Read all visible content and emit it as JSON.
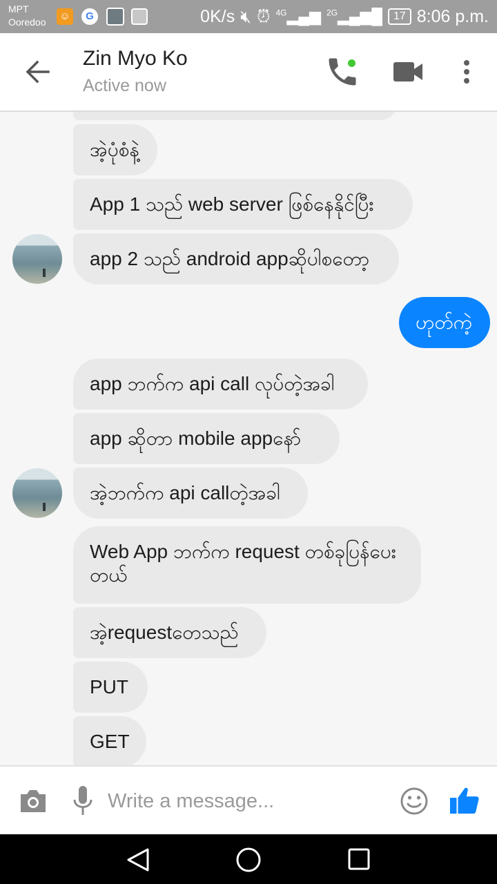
{
  "status_bar": {
    "carrier_1": "MPT",
    "carrier_2": "Ooredoo",
    "speed": "0K/s",
    "net_1": "4G",
    "net_2": "2G",
    "battery": "17",
    "time": "8:06 p.m."
  },
  "header": {
    "contact_name": "Zin Myo Ko",
    "status": "Active now"
  },
  "messages": [
    {
      "text": "အဲ့ပုံစံနဲ့",
      "from": "them"
    },
    {
      "text": "App 1 သည် web server ဖြစ်နေနိုင်ပြီး",
      "from": "them"
    },
    {
      "text": "app 2 သည် android appဆိုပါစတော့",
      "from": "them"
    },
    {
      "text": "ဟုတ်ကဲ့",
      "from": "me"
    },
    {
      "text": "app ဘက်က api call လုပ်တဲ့အခါ",
      "from": "them"
    },
    {
      "text": "app ဆိုတာ mobile appနော်",
      "from": "them"
    },
    {
      "text": "အဲ့ဘက်က api callတဲ့အခါ",
      "from": "them"
    },
    {
      "text": "Web App ဘက်က request တစ်ခုပြန်ပေးတယ်",
      "from": "them"
    },
    {
      "text": "အဲ့requestတေသည်",
      "from": "them"
    },
    {
      "text": "PUT",
      "from": "them"
    },
    {
      "text": "GET",
      "from": "them"
    }
  ],
  "composer": {
    "placeholder": "Write a message..."
  },
  "colors": {
    "accent": "#0a84ff",
    "online": "#42c833",
    "incoming_bubble": "#e9e9e9"
  }
}
